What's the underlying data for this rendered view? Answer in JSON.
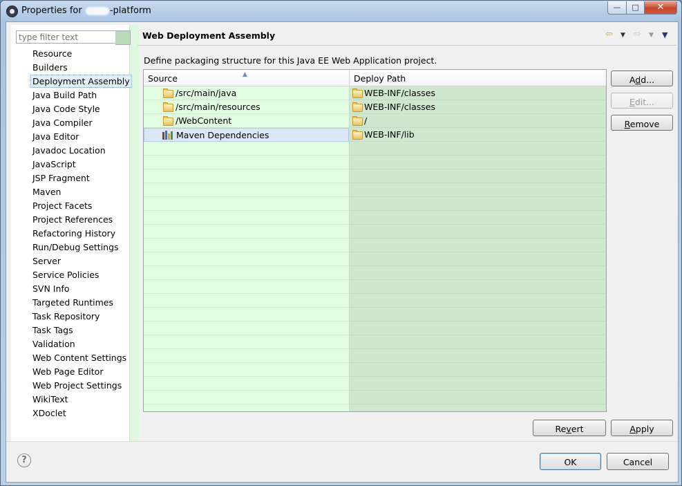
{
  "window": {
    "title_prefix": "Properties for ",
    "title_suffix": "-platform",
    "controls": {
      "minimize": "—",
      "maximize": "□",
      "close": "✕"
    }
  },
  "sidebar": {
    "filter_placeholder": "type filter text",
    "items": [
      "Resource",
      "Builders",
      "Deployment Assembly",
      "Java Build Path",
      "Java Code Style",
      "Java Compiler",
      "Java Editor",
      "Javadoc Location",
      "JavaScript",
      "JSP Fragment",
      "Maven",
      "Project Facets",
      "Project References",
      "Refactoring History",
      "Run/Debug Settings",
      "Server",
      "Service Policies",
      "SVN Info",
      "Targeted Runtimes",
      "Task Repository",
      "Task Tags",
      "Validation",
      "Web Content Settings",
      "Web Page Editor",
      "Web Project Settings",
      "WikiText",
      "XDoclet"
    ],
    "selected_index": 2
  },
  "page": {
    "title": "Web Deployment Assembly",
    "description": "Define packaging structure for this Java EE Web Application project.",
    "nav_icons": [
      "back-arrow-icon",
      "dropdown-icon",
      "forward-arrow-icon",
      "dropdown-icon",
      "menu-icon"
    ]
  },
  "table": {
    "columns": [
      "Source",
      "Deploy Path"
    ],
    "rows": [
      {
        "source": "/src/main/java",
        "deploy": "WEB-INF/classes",
        "icon": "folder-icon"
      },
      {
        "source": "/src/main/resources",
        "deploy": "WEB-INF/classes",
        "icon": "folder-icon"
      },
      {
        "source": "/WebContent",
        "deploy": "/",
        "icon": "folder-icon"
      },
      {
        "source": "Maven Dependencies",
        "deploy": "WEB-INF/lib",
        "icon": "library-icon"
      }
    ],
    "selected_row": 3
  },
  "buttons": {
    "add": {
      "pre": "A",
      "key": "d",
      "post": "d..."
    },
    "edit": {
      "pre": "",
      "key": "E",
      "post": "dit..."
    },
    "remove": {
      "pre": "",
      "key": "R",
      "post": "emove"
    },
    "revert": {
      "pre": "Re",
      "key": "v",
      "post": "ert"
    },
    "apply": {
      "pre": "",
      "key": "A",
      "post": "pply"
    },
    "ok": "OK",
    "cancel": "Cancel",
    "help": "?"
  },
  "colors": {
    "title_bar": "#b9cfe8",
    "source_column": "#e1fde1",
    "deploy_column": "#cfe7cf",
    "selection": "#dbe7f6"
  }
}
